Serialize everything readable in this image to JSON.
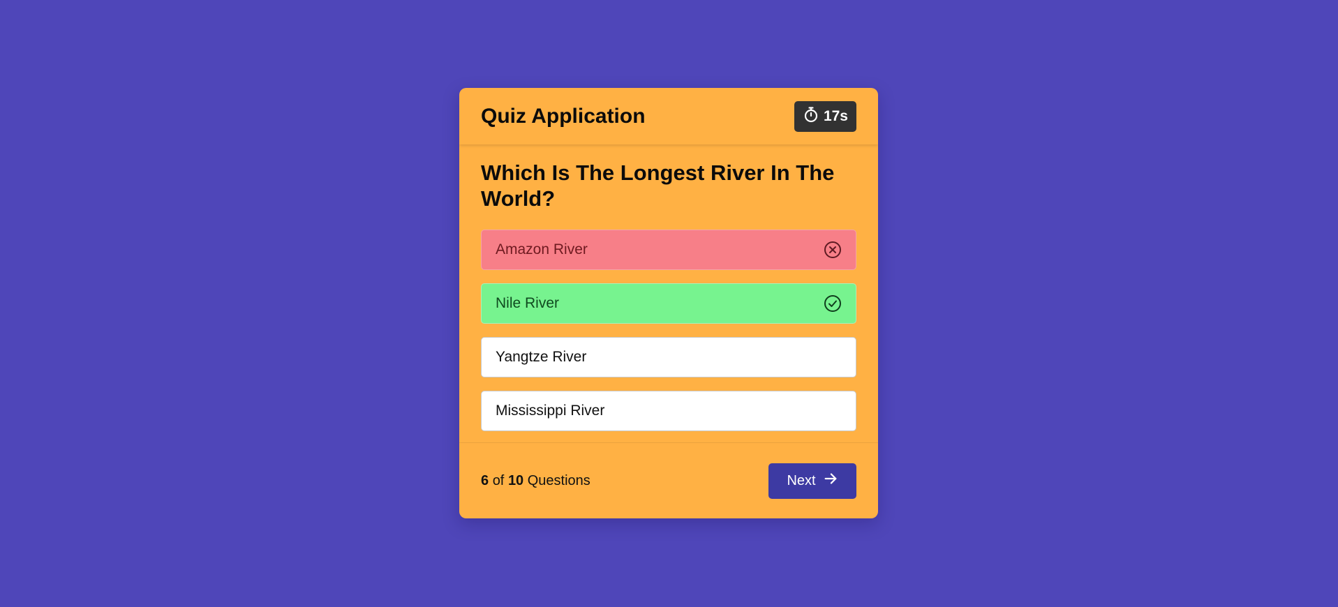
{
  "app": {
    "title": "Quiz Application",
    "timer_value": "17s",
    "timer_icon": "stopwatch-icon"
  },
  "question": {
    "text": "Which Is The Longest River In The World?"
  },
  "options": [
    {
      "label": "Amazon River",
      "state": "wrong",
      "icon": "x-circle-icon"
    },
    {
      "label": "Nile River",
      "state": "correct",
      "icon": "check-circle-icon"
    },
    {
      "label": "Yangtze River",
      "state": "neutral"
    },
    {
      "label": "Mississippi River",
      "state": "neutral"
    }
  ],
  "footer": {
    "current": "6",
    "of_text": "of",
    "total": "10",
    "questions_text": "Questions",
    "next_label": "Next",
    "next_icon": "arrow-right-icon"
  },
  "colors": {
    "background": "#4f46b9",
    "card": "#ffb144",
    "wrong": "#f77f88",
    "correct": "#77f38f",
    "button": "#3d3aa3",
    "timer": "#323232"
  }
}
